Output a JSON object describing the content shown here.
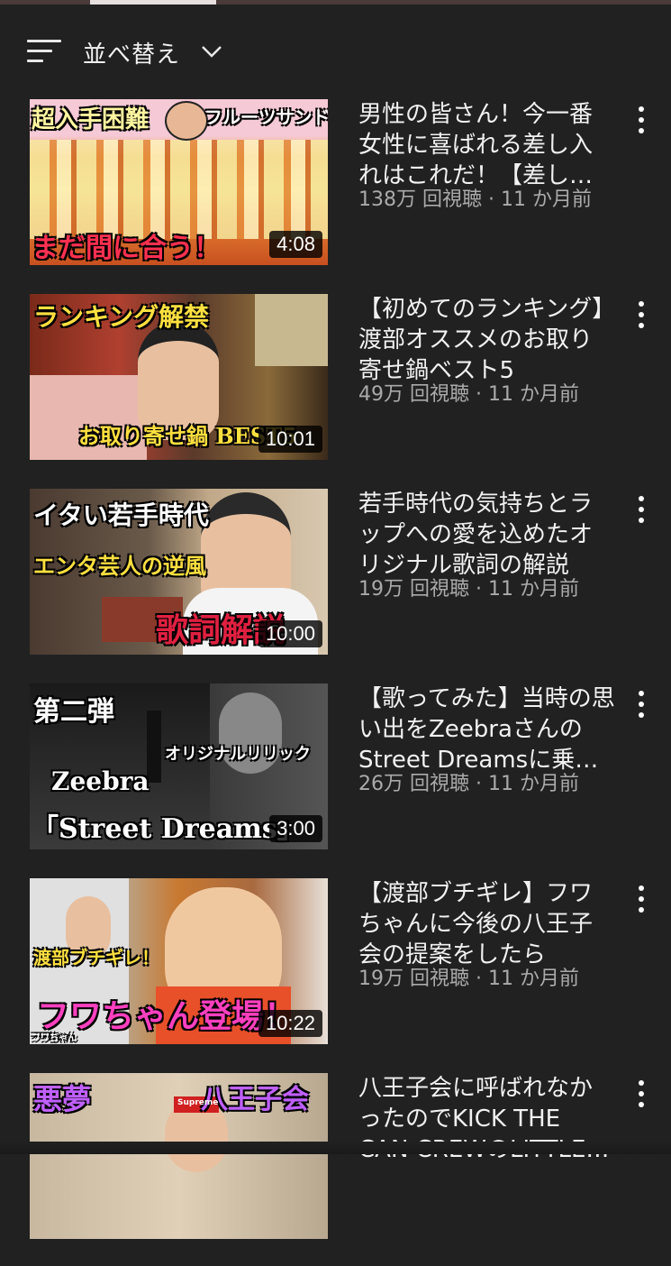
{
  "sort": {
    "label": "並べ替え"
  },
  "videos": [
    {
      "title": "男性の皆さん！今一番女性に喜ばれる差し入れはこれだ！【差し入れ】",
      "meta": "138万 回視聴 · 11 か月前",
      "duration": "4:08",
      "captions": [
        "超入手困難",
        "フルーツサンド",
        "まだ間に合う！"
      ]
    },
    {
      "title": "【初めてのランキング】渡部オススメのお取り寄せ鍋ベスト5",
      "meta": "49万 回視聴 · 11 か月前",
      "duration": "10:01",
      "captions": [
        "ランキング解禁",
        "お取り寄せ鍋 BEST5"
      ]
    },
    {
      "title": "若手時代の気持ちとラップへの愛を込めたオリジナル歌詞の解説",
      "meta": "19万 回視聴 · 11 か月前",
      "duration": "10:00",
      "captions": [
        "イタい若手時代",
        "エンタ芸人の逆風",
        "歌詞解説"
      ]
    },
    {
      "title": "【歌ってみた】当時の思い出をZeebraさんのStreet Dreamsに乗せて",
      "meta": "26万 回視聴 · 11 か月前",
      "duration": "3:00",
      "captions": [
        "第二弾",
        "オリジナルリリック",
        "Zeebra",
        "「Street Dreams」"
      ]
    },
    {
      "title": "【渡部ブチギレ】フワちゃんに今後の八王子会の提案をしたら",
      "meta": "19万 回視聴 · 11 か月前",
      "duration": "10:22",
      "captions": [
        "渡部ブチギレ！",
        "フワちゃん登場！",
        "フワちゃん"
      ]
    },
    {
      "title": "八王子会に呼ばれなかったのでKICK THE CAN CREWのLITTLEさんと",
      "meta": "",
      "duration": "",
      "captions": [
        "悪夢",
        "八王子会",
        "Supreme"
      ]
    }
  ],
  "colors": {
    "background": "#212121",
    "meta_text": "#aaaaaa"
  },
  "icons": [
    "sort-icon",
    "chevron-down-icon",
    "more-vert-icon"
  ]
}
